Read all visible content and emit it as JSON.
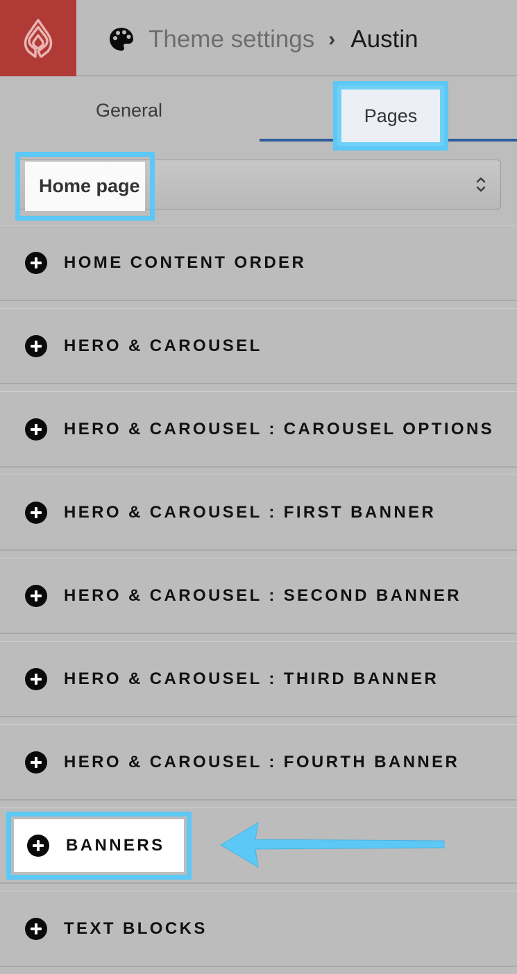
{
  "header": {
    "logo_icon": "lightspeed-logo-icon",
    "palette_icon": "palette-icon",
    "breadcrumb_parent": "Theme settings",
    "breadcrumb_separator_icon": "chevron-right-icon",
    "breadcrumb_current": "Austin"
  },
  "tabs": [
    {
      "label": "General",
      "active": false
    },
    {
      "label": "Pages",
      "active": true
    }
  ],
  "page_select": {
    "value": "Home page",
    "arrow_icon": "up-down-chevron-icon"
  },
  "sections": [
    {
      "label": "HOME CONTENT ORDER",
      "icon": "plus-circle-icon"
    },
    {
      "label": "HERO & CAROUSEL",
      "icon": "plus-circle-icon"
    },
    {
      "label": "HERO & CAROUSEL : CAROUSEL OPTIONS",
      "icon": "plus-circle-icon"
    },
    {
      "label": "HERO & CAROUSEL : FIRST BANNER",
      "icon": "plus-circle-icon"
    },
    {
      "label": "HERO & CAROUSEL : SECOND BANNER",
      "icon": "plus-circle-icon"
    },
    {
      "label": "HERO & CAROUSEL : THIRD BANNER",
      "icon": "plus-circle-icon"
    },
    {
      "label": "HERO & CAROUSEL : FOURTH BANNER",
      "icon": "plus-circle-icon"
    },
    {
      "label": "BANNERS",
      "icon": "plus-circle-icon",
      "highlighted": true
    },
    {
      "label": "TEXT BLOCKS",
      "icon": "plus-circle-icon"
    }
  ],
  "colors": {
    "brand_red": "#b03a36",
    "highlight_blue": "#5bc8f5",
    "tab_underline": "#2f5d9c",
    "overlay_gray": "#bdbdbd"
  },
  "annotation_icon": "left-arrow-icon"
}
